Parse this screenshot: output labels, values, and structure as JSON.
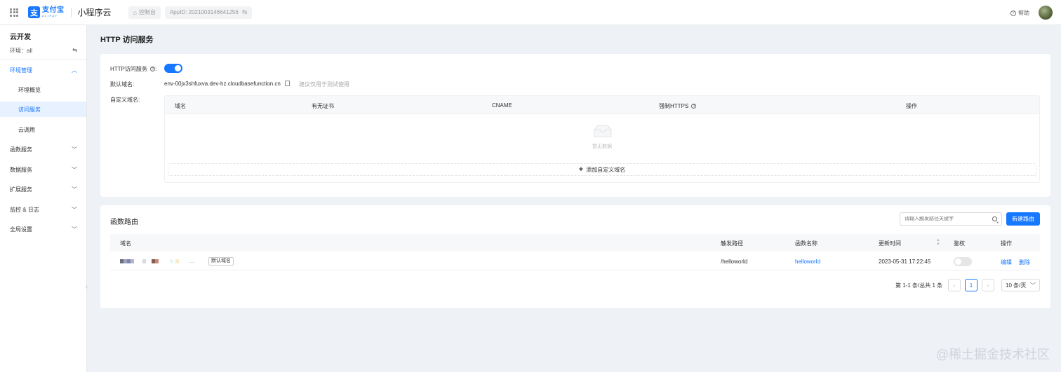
{
  "topbar": {
    "logo_cn": "支付宝",
    "logo_en": "ALIPAY",
    "product": "小程序云",
    "console": "控制台",
    "app_id": "AppID: 2021003146641256",
    "help": "帮助"
  },
  "sidebar": {
    "title": "云开发",
    "env_label": "环境：all",
    "groups": [
      {
        "label": "环境管理",
        "expanded": true
      },
      {
        "label": "函数服务"
      },
      {
        "label": "数据服务"
      },
      {
        "label": "扩展服务"
      },
      {
        "label": "监控 & 日志"
      },
      {
        "label": "全局设置"
      }
    ],
    "sub_items": [
      "环境概览",
      "访问服务",
      "云调用"
    ],
    "active_sub": "访问服务"
  },
  "page_title": "HTTP 访问服务",
  "http_service": {
    "toggle_label": "HTTP访问服务",
    "toggle_on": true,
    "default_domain_label": "默认域名:",
    "default_domain": "env-00jx3shfuxva.dev-hz.cloudbasefunction.cn",
    "domain_hint": "建议仅用于测试使用",
    "custom_domain_label": "自定义域名:",
    "columns": [
      "域名",
      "有无证书",
      "CNAME",
      "强制HTTPS",
      "操作"
    ],
    "empty_text": "暂无数据",
    "add_button": "添加自定义域名"
  },
  "routes": {
    "title": "函数路由",
    "search_placeholder": "请输入触发路径关键字",
    "new_button": "新建路由",
    "columns": [
      "域名",
      "触发路径",
      "函数名称",
      "更新时间",
      "鉴权",
      "操作"
    ],
    "rows": [
      {
        "domain_suffix": "...",
        "tag": "默认域名",
        "path": "/helloworld",
        "function": "helloworld",
        "updated": "2023-05-31 17:22:45",
        "auth": false,
        "edit": "编辑",
        "delete": "删除"
      }
    ],
    "pager": {
      "summary": "第 1-1 条/总共 1 条",
      "current_page": "1",
      "page_size": "10 条/页"
    }
  },
  "watermark": "@稀土掘金技术社区",
  "colors": {
    "primary": "#1677ff",
    "active_bg": "#e8f1ff"
  }
}
